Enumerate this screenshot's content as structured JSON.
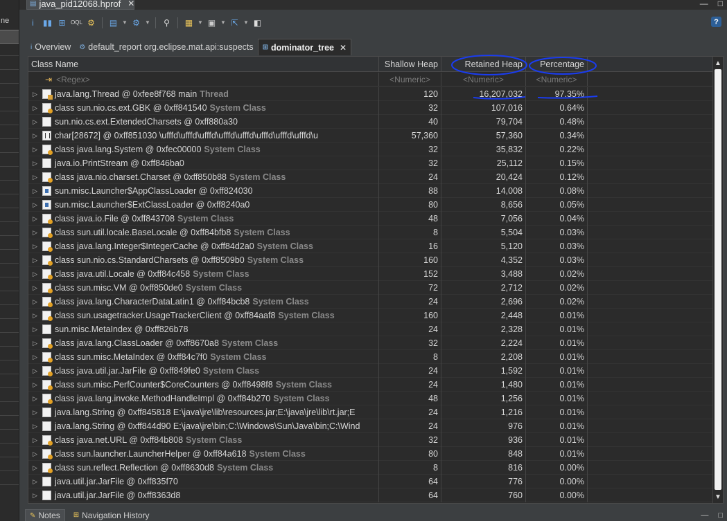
{
  "left_panel": {
    "label": "ne"
  },
  "editor_tab": {
    "title": "java_pid12068.hprof",
    "close": "✕"
  },
  "window_controls": {
    "minimize": "—",
    "maximize": "□"
  },
  "toolbar": {
    "icons": [
      "info-icon",
      "histogram-icon",
      "dominator-tree-icon",
      "oql-icon",
      "threads-icon",
      "run-report-icon",
      "query-browser-icon",
      "search-icon",
      "group-by-icon",
      "calculate-retained-icon",
      "export-icon",
      "find-object-icon"
    ],
    "help": "?"
  },
  "view_tabs": [
    {
      "label": "Overview",
      "icon": "i"
    },
    {
      "label": "default_report  org.eclipse.mat.api:suspects",
      "icon": "⚙"
    },
    {
      "label": "dominator_tree",
      "icon": "⊞",
      "close": "✕"
    }
  ],
  "table": {
    "columns": {
      "name": "Class Name",
      "shallow": "Shallow Heap",
      "retained": "Retained Heap",
      "percentage": "Percentage"
    },
    "filters": {
      "name": "<Regex>",
      "shallow": "<Numeric>",
      "retained": "<Numeric>",
      "percentage": "<Numeric>"
    },
    "rows": [
      {
        "icon": "thread",
        "label": "java.lang.Thread @ 0xfee8f768  main",
        "suffix": "Thread",
        "shallow": "120",
        "retained": "16,207,032",
        "pct": "97.35%"
      },
      {
        "icon": "cls",
        "label": "class sun.nio.cs.ext.GBK @ 0xff841540",
        "suffix": "System Class",
        "shallow": "32",
        "retained": "107,016",
        "pct": "0.64%"
      },
      {
        "icon": "page",
        "label": "sun.nio.cs.ext.ExtendedCharsets @ 0xff880a30",
        "suffix": "",
        "shallow": "40",
        "retained": "79,704",
        "pct": "0.48%"
      },
      {
        "icon": "arr",
        "label": "char[28672] @ 0xff851030  \\ufffd\\ufffd\\ufffd\\ufffd\\ufffd\\ufffd\\ufffd\\ufffd\\u",
        "suffix": "",
        "shallow": "57,360",
        "retained": "57,360",
        "pct": "0.34%"
      },
      {
        "icon": "cls",
        "label": "class java.lang.System @ 0xfec00000",
        "suffix": "System Class",
        "shallow": "32",
        "retained": "35,832",
        "pct": "0.22%"
      },
      {
        "icon": "page",
        "label": "java.io.PrintStream @ 0xff846ba0",
        "suffix": "",
        "shallow": "32",
        "retained": "25,112",
        "pct": "0.15%"
      },
      {
        "icon": "cls",
        "label": "class java.nio.charset.Charset @ 0xff850b88",
        "suffix": "System Class",
        "shallow": "24",
        "retained": "20,424",
        "pct": "0.12%"
      },
      {
        "icon": "loader",
        "label": "sun.misc.Launcher$AppClassLoader @ 0xff824030",
        "suffix": "",
        "shallow": "88",
        "retained": "14,008",
        "pct": "0.08%"
      },
      {
        "icon": "loader",
        "label": "sun.misc.Launcher$ExtClassLoader @ 0xff8240a0",
        "suffix": "",
        "shallow": "80",
        "retained": "8,656",
        "pct": "0.05%"
      },
      {
        "icon": "cls",
        "label": "class java.io.File @ 0xff843708",
        "suffix": "System Class",
        "shallow": "48",
        "retained": "7,056",
        "pct": "0.04%"
      },
      {
        "icon": "cls",
        "label": "class sun.util.locale.BaseLocale @ 0xff84bfb8",
        "suffix": "System Class",
        "shallow": "8",
        "retained": "5,504",
        "pct": "0.03%"
      },
      {
        "icon": "cls",
        "label": "class java.lang.Integer$IntegerCache @ 0xff84d2a0",
        "suffix": "System Class",
        "shallow": "16",
        "retained": "5,120",
        "pct": "0.03%"
      },
      {
        "icon": "cls",
        "label": "class sun.nio.cs.StandardCharsets @ 0xff8509b0",
        "suffix": "System Class",
        "shallow": "160",
        "retained": "4,352",
        "pct": "0.03%"
      },
      {
        "icon": "cls",
        "label": "class java.util.Locale @ 0xff84c458",
        "suffix": "System Class",
        "shallow": "152",
        "retained": "3,488",
        "pct": "0.02%"
      },
      {
        "icon": "cls",
        "label": "class sun.misc.VM @ 0xff850de0",
        "suffix": "System Class",
        "shallow": "72",
        "retained": "2,712",
        "pct": "0.02%"
      },
      {
        "icon": "cls",
        "label": "class java.lang.CharacterDataLatin1 @ 0xff84bcb8",
        "suffix": "System Class",
        "shallow": "24",
        "retained": "2,696",
        "pct": "0.02%"
      },
      {
        "icon": "cls",
        "label": "class sun.usagetracker.UsageTrackerClient @ 0xff84aaf8",
        "suffix": "System Class",
        "shallow": "160",
        "retained": "2,448",
        "pct": "0.01%"
      },
      {
        "icon": "page",
        "label": "sun.misc.MetaIndex @ 0xff826b78",
        "suffix": "",
        "shallow": "24",
        "retained": "2,328",
        "pct": "0.01%"
      },
      {
        "icon": "cls",
        "label": "class java.lang.ClassLoader @ 0xff8670a8",
        "suffix": "System Class",
        "shallow": "32",
        "retained": "2,224",
        "pct": "0.01%"
      },
      {
        "icon": "cls",
        "label": "class sun.misc.MetaIndex @ 0xff84c7f0",
        "suffix": "System Class",
        "shallow": "8",
        "retained": "2,208",
        "pct": "0.01%"
      },
      {
        "icon": "cls",
        "label": "class java.util.jar.JarFile @ 0xff849fe0",
        "suffix": "System Class",
        "shallow": "24",
        "retained": "1,592",
        "pct": "0.01%"
      },
      {
        "icon": "cls",
        "label": "class sun.misc.PerfCounter$CoreCounters @ 0xff8498f8",
        "suffix": "System Class",
        "shallow": "24",
        "retained": "1,480",
        "pct": "0.01%"
      },
      {
        "icon": "cls",
        "label": "class java.lang.invoke.MethodHandleImpl @ 0xff84b270",
        "suffix": "System Class",
        "shallow": "48",
        "retained": "1,256",
        "pct": "0.01%"
      },
      {
        "icon": "page",
        "label": "java.lang.String @ 0xff845818  E:\\java\\jre\\lib\\resources.jar;E:\\java\\jre\\lib\\rt.jar;E",
        "suffix": "",
        "shallow": "24",
        "retained": "1,216",
        "pct": "0.01%"
      },
      {
        "icon": "page",
        "label": "java.lang.String @ 0xff844d90  E:\\java\\jre\\bin;C:\\Windows\\Sun\\Java\\bin;C:\\Wind",
        "suffix": "",
        "shallow": "24",
        "retained": "976",
        "pct": "0.01%"
      },
      {
        "icon": "cls",
        "label": "class java.net.URL @ 0xff84b808",
        "suffix": "System Class",
        "shallow": "32",
        "retained": "936",
        "pct": "0.01%"
      },
      {
        "icon": "cls",
        "label": "class sun.launcher.LauncherHelper @ 0xff84a618",
        "suffix": "System Class",
        "shallow": "80",
        "retained": "848",
        "pct": "0.01%"
      },
      {
        "icon": "cls",
        "label": "class sun.reflect.Reflection @ 0xff8630d8",
        "suffix": "System Class",
        "shallow": "8",
        "retained": "816",
        "pct": "0.00%"
      },
      {
        "icon": "page",
        "label": "java.util.jar.JarFile @ 0xff835f70",
        "suffix": "",
        "shallow": "64",
        "retained": "776",
        "pct": "0.00%"
      },
      {
        "icon": "page",
        "label": "java.util.jar.JarFile @ 0xff8363d8",
        "suffix": "",
        "shallow": "64",
        "retained": "760",
        "pct": "0.00%"
      }
    ]
  },
  "annotation": {
    "color": "#1a3cf0"
  },
  "scrollbar": {
    "up": "▲",
    "down": "▼"
  },
  "bottom_tabs": [
    {
      "label": "Notes",
      "icon": "✎"
    },
    {
      "label": "Navigation History",
      "icon": "⊞"
    }
  ]
}
